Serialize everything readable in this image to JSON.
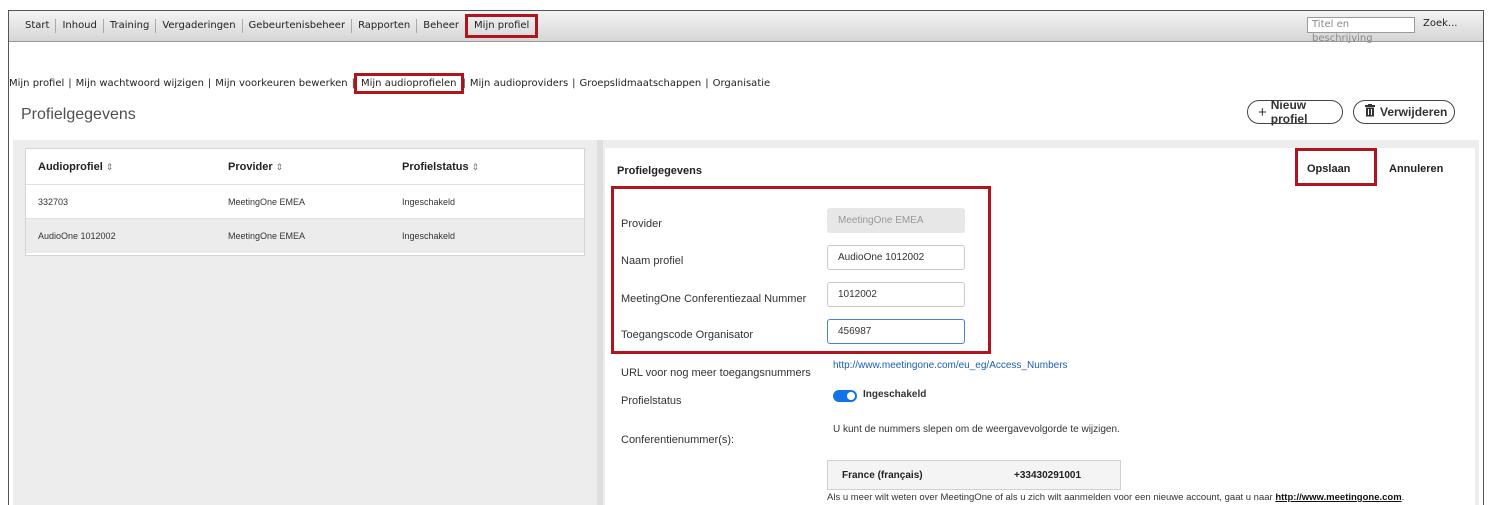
{
  "topnav": {
    "items": [
      "Start",
      "Inhoud",
      "Training",
      "Vergaderingen",
      "Gebeurtenisbeheer",
      "Rapporten",
      "Beheer",
      "Mijn profiel"
    ],
    "search_placeholder": "Titel en beschrijving",
    "search_button": "Zoek..."
  },
  "subnav": {
    "items": [
      "Mijn profiel",
      "Mijn wachtwoord wijzigen",
      "Mijn voorkeuren bewerken",
      "Mijn audioprofielen",
      "Mijn audioproviders",
      "Groepslidmaatschappen",
      "Organisatie"
    ],
    "separator": "|"
  },
  "header": {
    "title": "Profielgegevens",
    "new_profile": "Nieuw profiel",
    "delete": "Verwijderen"
  },
  "list": {
    "columns": [
      "Audioprofiel",
      "Provider",
      "Profielstatus"
    ],
    "sort_glyph": "⇕",
    "rows": [
      {
        "profile": "332703",
        "provider": "MeetingOne EMEA",
        "status": "Ingeschakeld"
      },
      {
        "profile": "AudioOne 1012002",
        "provider": "MeetingOne EMEA",
        "status": "Ingeschakeld"
      }
    ]
  },
  "details": {
    "title": "Profielgegevens",
    "save": "Opslaan",
    "cancel": "Annuleren",
    "provider_label": "Provider",
    "provider_value": "MeetingOne EMEA",
    "name_label": "Naam profiel",
    "name_value": "AudioOne 1012002",
    "conf_label": "MeetingOne Conferentiezaal Nummer",
    "conf_value": "1012002",
    "code_label": "Toegangscode Organisator",
    "code_value": "456987",
    "url_label": "URL voor nog meer toegangsnummers",
    "url_value": "http://www.meetingone.com/eu_eg/Access_Numbers",
    "status_label": "Profielstatus",
    "status_value": "Ingeschakeld",
    "numbers_label": "Conferentienummer(s):",
    "numbers_hint": "U kunt de nummers slepen om de weergavevolgorde te wijzigen.",
    "number_country": "France (français)",
    "number_value": "+33430291001",
    "footer_text": "Als u meer wilt weten over MeetingOne of als u zich wilt aanmelden voor een nieuwe account, gaat u naar",
    "footer_link": "http://www.meetingone.com",
    "footer_end": "."
  },
  "colors": {
    "accent": "#1473e6",
    "highlight": "#b0141c",
    "link": "#1a5fb4"
  }
}
